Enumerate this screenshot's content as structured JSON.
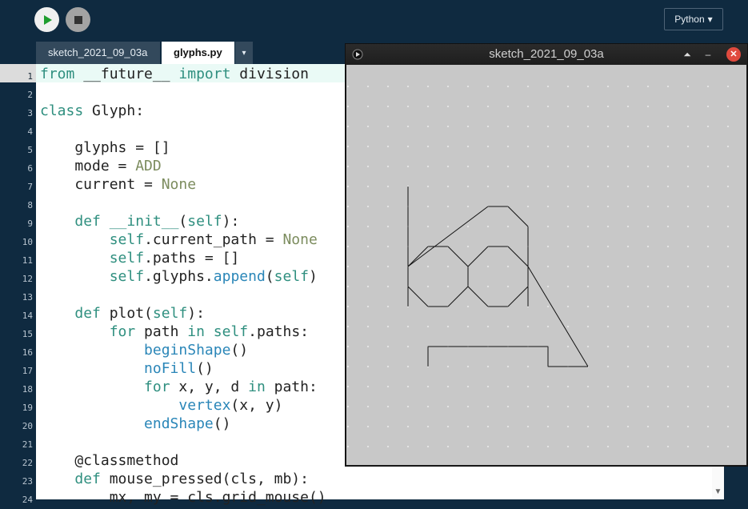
{
  "toolbar": {
    "run_icon": "play-icon",
    "stop_icon": "stop-icon",
    "mode_label": "Python",
    "mode_arrow": "▾"
  },
  "tabs": [
    {
      "label": "sketch_2021_09_03a"
    },
    {
      "label": "glyphs.py"
    }
  ],
  "tab_menu_icon": "▾",
  "editor": {
    "line_numbers": [
      "1",
      "2",
      "3",
      "4",
      "5",
      "6",
      "7",
      "8",
      "9",
      "10",
      "11",
      "12",
      "13",
      "14",
      "15",
      "16",
      "17",
      "18",
      "19",
      "20",
      "21",
      "22",
      "23",
      "24"
    ],
    "current_line": 1
  },
  "sketch_window": {
    "title": "sketch_2021_09_03a",
    "buttons": [
      "⏶",
      "–",
      "✕"
    ]
  }
}
